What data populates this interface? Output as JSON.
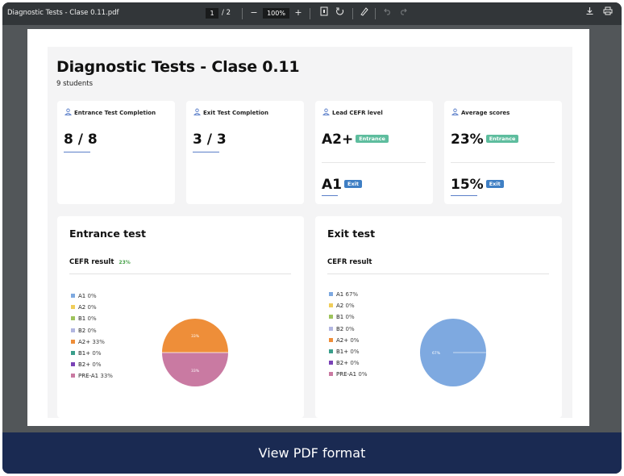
{
  "toolbar": {
    "filename": "Diagnostic Tests - Clase 0.11.pdf",
    "current_page": "1",
    "page_total": "/ 2",
    "zoom_out": "−",
    "zoom": "100%",
    "zoom_in": "+"
  },
  "report": {
    "title": "Diagnostic Tests - Clase 0.11",
    "subtitle": "9 students",
    "cards": {
      "entrance": {
        "label": "Entrance Test Completion",
        "value": "8 / 8"
      },
      "exit": {
        "label": "Exit Test Completion",
        "value": "3 / 3"
      },
      "cefr": {
        "label": "Lead CEFR level",
        "entrance_value": "A2+",
        "entrance_tag": "Entrance",
        "exit_value": "A1",
        "exit_tag": "Exit"
      },
      "scores": {
        "label": "Average scores",
        "entrance_value": "23%",
        "entrance_tag": "Entrance",
        "exit_value": "15%",
        "exit_tag": "Exit"
      }
    },
    "entrance_panel": {
      "title": "Entrance test",
      "subtitle": "CEFR result",
      "score": "23%",
      "legend": [
        {
          "label": "A1",
          "value": "0%",
          "color": "#7ea9e0"
        },
        {
          "label": "A2",
          "value": "0%",
          "color": "#f0cd5a"
        },
        {
          "label": "B1",
          "value": "0%",
          "color": "#9ec35c"
        },
        {
          "label": "B2",
          "value": "0%",
          "color": "#b2b6e0"
        },
        {
          "label": "A2+",
          "value": "33%",
          "color": "#ee8e39"
        },
        {
          "label": "B1+",
          "value": "0%",
          "color": "#3a9e8b"
        },
        {
          "label": "B2+",
          "value": "0%",
          "color": "#7a42b6"
        },
        {
          "label": "PRE-A1",
          "value": "33%",
          "color": "#c97aa2"
        }
      ],
      "pie_labels": {
        "top": "33%",
        "bottom": "33%"
      }
    },
    "exit_panel": {
      "title": "Exit test",
      "subtitle": "CEFR result",
      "legend": [
        {
          "label": "A1",
          "value": "67%",
          "color": "#7ea9e0"
        },
        {
          "label": "A2",
          "value": "0%",
          "color": "#f0cd5a"
        },
        {
          "label": "B1",
          "value": "0%",
          "color": "#9ec35c"
        },
        {
          "label": "B2",
          "value": "0%",
          "color": "#b2b6e0"
        },
        {
          "label": "A2+",
          "value": "0%",
          "color": "#ee8e39"
        },
        {
          "label": "B1+",
          "value": "0%",
          "color": "#3a9e8b"
        },
        {
          "label": "B2+",
          "value": "0%",
          "color": "#7a42b6"
        },
        {
          "label": "PRE-A1",
          "value": "0%",
          "color": "#c97aa2"
        }
      ],
      "pie_label": "67%"
    }
  },
  "footer": {
    "label": "View PDF format"
  }
}
